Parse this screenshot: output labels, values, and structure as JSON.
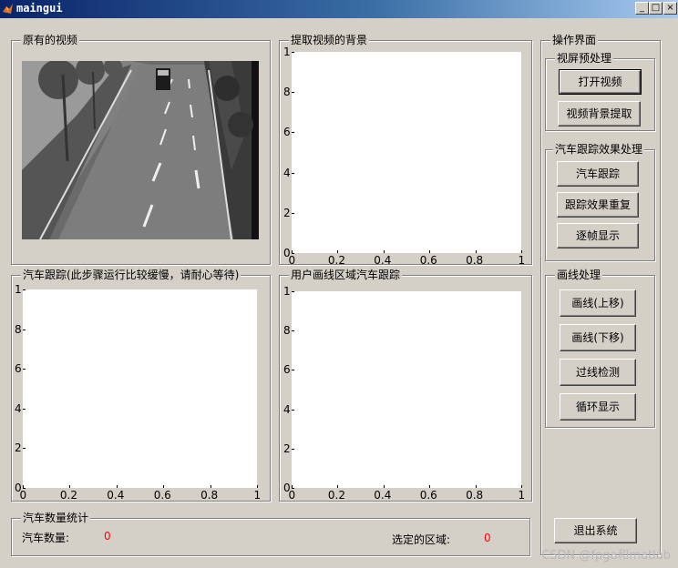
{
  "window": {
    "title": "maingui"
  },
  "panels": {
    "original_video": "原有的视频",
    "background": "提取视频的背景",
    "tracking": "汽车跟踪(此步骤运行比较缓慢，请耐心等待)",
    "user_region": "用户画线区域汽车跟踪",
    "operations": "操作界面",
    "preprocess": "视屏预处理",
    "tracking_effect": "汽车跟踪效果处理",
    "line_process": "画线处理",
    "stats": "汽车数量统计"
  },
  "buttons": {
    "open_video": "打开视频",
    "bg_extract": "视频背景提取",
    "car_track": "汽车跟踪",
    "replay": "跟踪效果重复",
    "frame_by_frame": "逐帧显示",
    "line_up": "画线(上移)",
    "line_down": "画线(下移)",
    "line_check": "过线检测",
    "loop_show": "循环显示",
    "exit": "退出系统"
  },
  "axes_ticks": {
    "x": [
      "0",
      "0.2",
      "0.4",
      "0.6",
      "0.8",
      "1"
    ],
    "y": [
      "0",
      "2",
      "4",
      "6",
      "8",
      "1"
    ]
  },
  "stats": {
    "car_count_label": "汽车数量:",
    "car_count_value": "0",
    "region_label": "选定的区域:",
    "region_value": "0"
  },
  "watermark": "CSDN @fpga和matlab"
}
